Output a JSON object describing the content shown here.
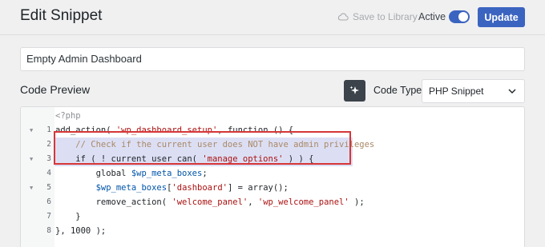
{
  "header": {
    "title": "Edit Snippet",
    "save_to_library": "Save to Library",
    "active_label": "Active",
    "active_on": true,
    "update_label": "Update"
  },
  "snippet": {
    "name": "Empty Admin Dashboard"
  },
  "code_preview": {
    "label": "Code Preview",
    "code_type_label": "Code Type",
    "code_type_value": "PHP Snippet",
    "php_open": "<?php",
    "lines": [
      {
        "num": "1",
        "fold": true
      },
      {
        "num": "2",
        "fold": false
      },
      {
        "num": "3",
        "fold": true
      },
      {
        "num": "4",
        "fold": false
      },
      {
        "num": "5",
        "fold": true
      },
      {
        "num": "6",
        "fold": false
      },
      {
        "num": "7",
        "fold": false
      },
      {
        "num": "8",
        "fold": false
      }
    ],
    "tokens": {
      "l1a": "add_action( ",
      "l1b": "'wp_dashboard_setup'",
      "l1c": ", function () {",
      "l2": "    // Check if the current user does NOT have admin privileges",
      "l3a": "    if ( ! current_user_can( ",
      "l3b": "'manage_options'",
      "l3c": " ) ) {",
      "l4a": "        global ",
      "l4b": "$wp_meta_boxes",
      "l4c": ";",
      "l5a": "        ",
      "l5b": "$wp_meta_boxes",
      "l5c": "[",
      "l5d": "'dashboard'",
      "l5e": "] = array();",
      "l6a": "        remove_action( ",
      "l6b": "'welcome_panel'",
      "l6c": ", ",
      "l6d": "'wp_welcome_panel'",
      "l6e": " );",
      "l7": "    }",
      "l8": "}, 1000 );"
    }
  },
  "colors": {
    "accent": "#3b64c0",
    "highlight_box": "#d63638"
  }
}
